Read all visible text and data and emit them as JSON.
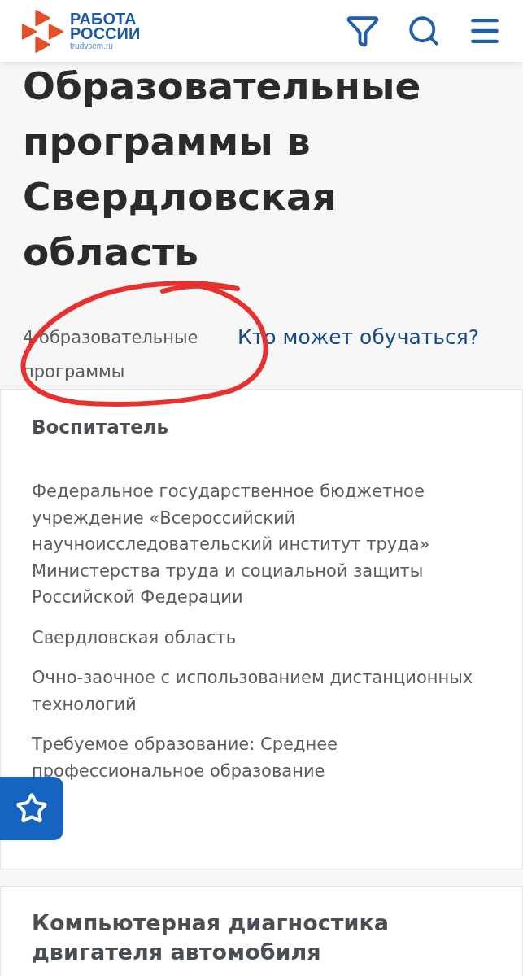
{
  "header": {
    "logo": {
      "name": "РАБОТА РОССИИ",
      "domain": "trudvsem.ru"
    }
  },
  "page_title": "Образовательные программы в Свердловская область",
  "summary": {
    "count": "4 образовательные программы",
    "link": "Кто может обучаться?"
  },
  "programs": [
    {
      "title": "Воспитатель",
      "organization": "Федеральное государственное бюджетное учреждение «Всероссийский научноисследовательский институт труда» Министерства труда и социальной защиты Российской Федерации",
      "region": "Свердловская область",
      "study_format": "Очно-заочное с использованием дистанционных технологий",
      "education_requirement": "Требуемое образование: Среднее профессиональное образование"
    },
    {
      "title": "Компьютерная диагностика двигателя автомобиля"
    }
  ]
}
